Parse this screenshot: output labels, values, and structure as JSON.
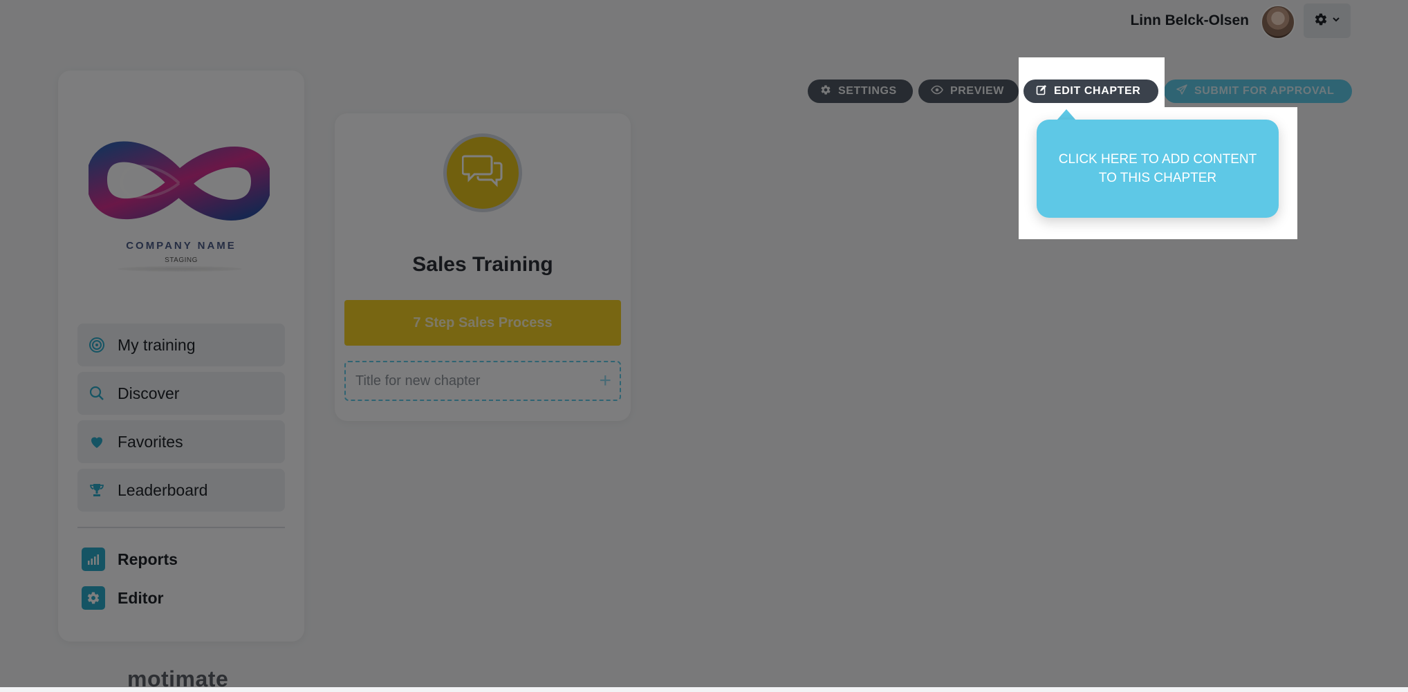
{
  "header": {
    "user_name": "Linn Belck-Olsen",
    "avatar_icon": "user-avatar",
    "settings_icon": "gear-icon"
  },
  "toolbar": {
    "settings_label": "SETTINGS",
    "preview_label": "PREVIEW",
    "edit_chapter_label": "EDIT CHAPTER",
    "submit_label": "SUBMIT FOR APPROVAL"
  },
  "tooltip": {
    "text": "CLICK HERE TO ADD CONTENT TO THIS CHAPTER"
  },
  "sidebar": {
    "logo": {
      "company_name": "COMPANY NAME",
      "environment": "STAGING"
    },
    "nav_items": [
      {
        "label": "My training",
        "icon": "target-icon"
      },
      {
        "label": "Discover",
        "icon": "search-icon"
      },
      {
        "label": "Favorites",
        "icon": "heart-icon"
      },
      {
        "label": "Leaderboard",
        "icon": "trophy-icon"
      }
    ],
    "admin_items": [
      {
        "label": "Reports",
        "icon": "bar-chart-icon"
      },
      {
        "label": "Editor",
        "icon": "gear-icon"
      }
    ],
    "brand": "motimate"
  },
  "course": {
    "title": "Sales Training",
    "icon": "chat-bubbles-icon",
    "chapters": [
      {
        "label": "7 Step Sales Process"
      }
    ],
    "new_chapter_placeholder": "Title for new chapter"
  },
  "colors": {
    "accent_teal": "#5ec8e6",
    "chapter_yellow": "#f1cc24",
    "dark_pill": "#4e5662"
  }
}
